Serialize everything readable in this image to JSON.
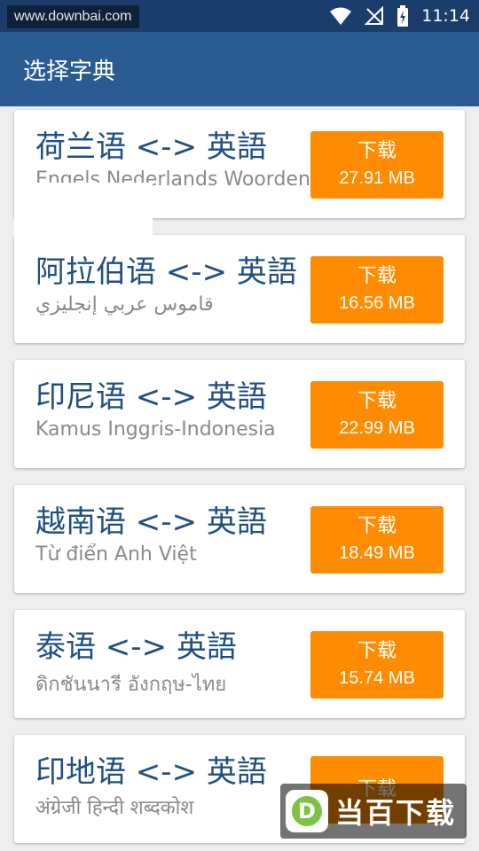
{
  "status_bar": {
    "watermark": "www.downbai.com",
    "time": "11:14",
    "icons": [
      "wifi-icon",
      "signal-off-icon",
      "battery-charging-icon"
    ]
  },
  "app_bar": {
    "title": "选择字典"
  },
  "dictionaries": [
    {
      "title": "荷兰语 <-> 英語",
      "subtitle": "Engels Nederlands Woordenboek",
      "button_label": "下载",
      "size": "27.91 MB"
    },
    {
      "title": "阿拉伯语 <-> 英語",
      "subtitle": "قاموس عربي إنجليزي",
      "button_label": "下载",
      "size": "16.56 MB"
    },
    {
      "title": "印尼语 <-> 英語",
      "subtitle": "Kamus Inggris-Indonesia",
      "button_label": "下载",
      "size": "22.99 MB"
    },
    {
      "title": "越南语 <-> 英語",
      "subtitle": "Từ điển Anh Việt",
      "button_label": "下载",
      "size": "18.49 MB"
    },
    {
      "title": "泰语 <-> 英語",
      "subtitle": "ดิกชันนารี อังกฤษ-ไทย",
      "button_label": "下载",
      "size": "15.74 MB"
    },
    {
      "title": "印地语 <-> 英語",
      "subtitle": "अंग्रेजी हिन्दी शब्दकोश",
      "button_label": "下载",
      "size": ""
    }
  ],
  "watermark_bottom": {
    "logo_letter": "D",
    "text": "当百下载"
  },
  "colors": {
    "status_bar": "#1a3d6b",
    "app_bar": "#2a5b92",
    "title_text": "#1f4f82",
    "download_button": "#ff8c00",
    "background": "#eeeeee"
  }
}
